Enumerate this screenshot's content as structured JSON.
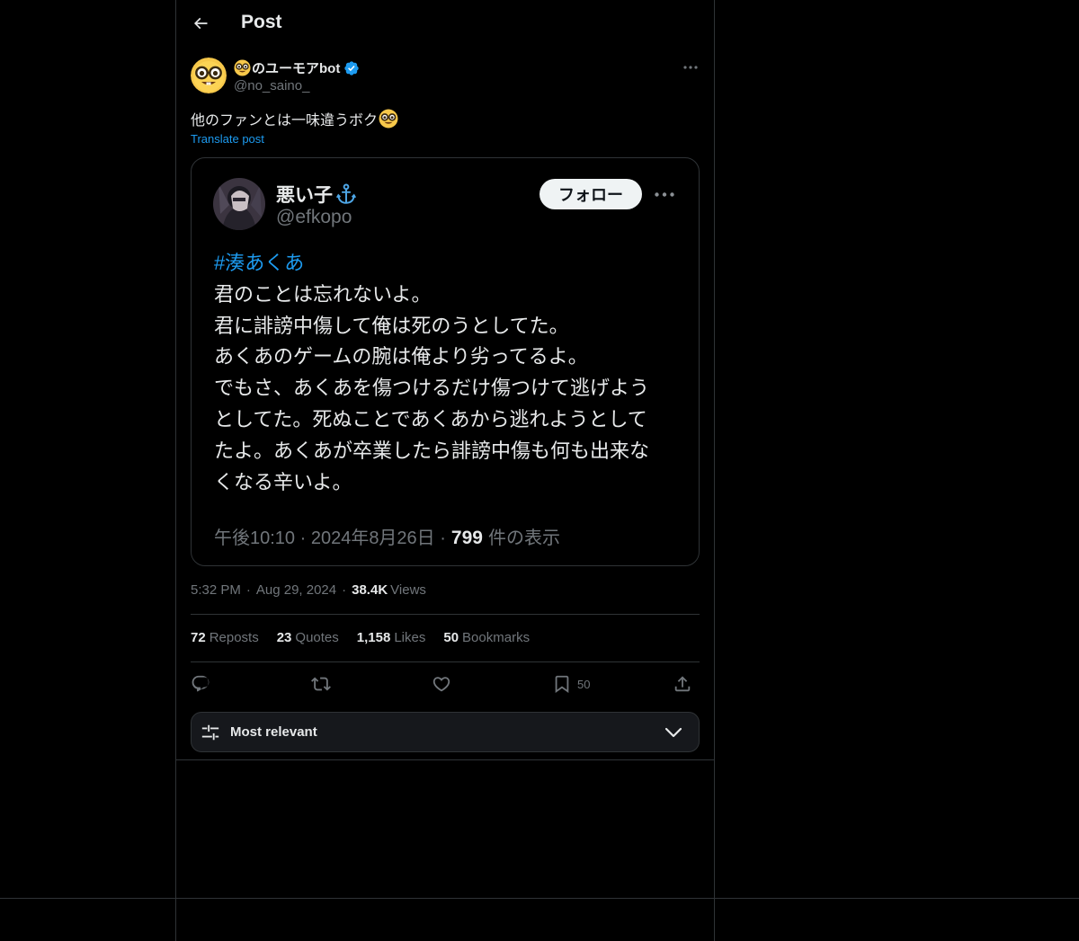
{
  "header": {
    "title": "Post"
  },
  "post": {
    "author_name": "のユーモアbot",
    "author_handle": "@no_saino_",
    "text": "他のファンとは一味違うボク",
    "translate_label": "Translate post",
    "time": "5:32 PM",
    "date": "Aug 29, 2024",
    "views_count": "38.4K",
    "views_label": "Views"
  },
  "media": {
    "name": "悪い子",
    "handle": "@efkopo",
    "follow_label": "フォロー",
    "hashtag": "#湊あくあ",
    "lines": [
      "君のことは忘れないよ。",
      "君に誹謗中傷して俺は死のうとしてた。",
      "あくあのゲームの腕は俺より劣ってるよ。",
      "でもさ、あくあを傷つけるだけ傷つけて逃げよう",
      "としてた。死ぬことであくあから逃れようとして",
      "たよ。あくあが卒業したら誹謗中傷も何も出来な",
      "くなる辛いよ。"
    ],
    "meta_time": "午後10:10 · 2024年8月26日 ·",
    "meta_views": "799",
    "meta_views_suffix": "件の表示"
  },
  "stats": {
    "reposts_num": "72",
    "reposts_label": "Reposts",
    "quotes_num": "23",
    "quotes_label": "Quotes",
    "likes_num": "1,158",
    "likes_label": "Likes",
    "bookmarks_num": "50",
    "bookmarks_label": "Bookmarks"
  },
  "actions": {
    "bookmark_count": "50"
  },
  "sort": {
    "label": "Most relevant"
  },
  "colors": {
    "background": "#000000",
    "text": "#e7e9ea",
    "muted": "#71767b",
    "accent": "#1d9bf0",
    "border": "#2f3336"
  },
  "icons": [
    "back-arrow-icon",
    "nerd-face-icon",
    "verified-badge-icon",
    "more-icon",
    "anchor-icon",
    "reply-icon",
    "repost-icon",
    "like-icon",
    "bookmark-icon",
    "share-icon",
    "sliders-icon",
    "chevron-down-icon"
  ]
}
